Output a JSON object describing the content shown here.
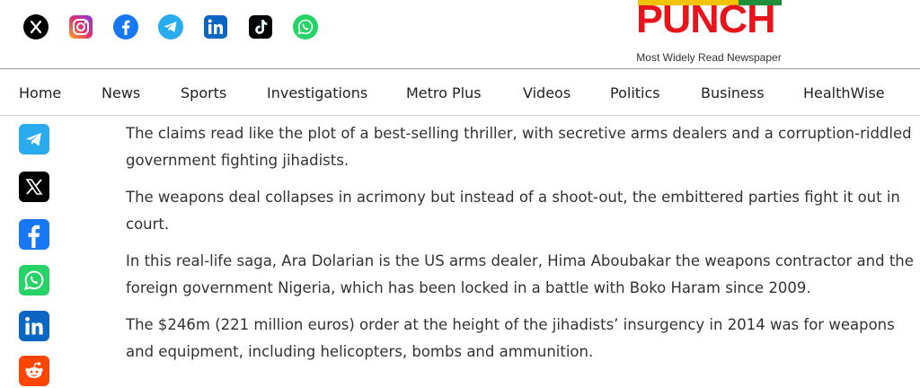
{
  "top_social": [
    {
      "name": "x-icon",
      "color": "#000000"
    },
    {
      "name": "instagram-icon",
      "color": "#e1306c"
    },
    {
      "name": "facebook-icon",
      "color": "#1877f2"
    },
    {
      "name": "telegram-icon",
      "color": "#2aabee"
    },
    {
      "name": "linkedin-icon",
      "color": "#0a66c2"
    },
    {
      "name": "tiktok-icon",
      "color": "#000000"
    },
    {
      "name": "whatsapp-icon",
      "color": "#25d366"
    }
  ],
  "logo": {
    "word": "PUNCH",
    "tagline": "Most Widely Read Newspaper",
    "colors": {
      "word": "#e8141b",
      "bar_yellow": "#f2c300",
      "bar_green": "#1f8f3a"
    }
  },
  "nav": {
    "items": [
      "Home",
      "News",
      "Sports",
      "Investigations",
      "Metro Plus",
      "Videos",
      "Politics",
      "Business",
      "HealthWise"
    ]
  },
  "share_bar": [
    {
      "name": "telegram-share-icon",
      "color": "#2aabee"
    },
    {
      "name": "x-share-icon",
      "color": "#000000"
    },
    {
      "name": "facebook-share-icon",
      "color": "#1877f2"
    },
    {
      "name": "whatsapp-share-icon",
      "color": "#25d366"
    },
    {
      "name": "linkedin-share-icon",
      "color": "#0a66c2"
    },
    {
      "name": "reddit-share-icon",
      "color": "#ff4500"
    }
  ],
  "article": {
    "paragraphs": [
      "The claims read like the plot of a best-selling thriller, with secretive arms dealers and a corruption-riddled government fighting jihadists.",
      "The weapons deal collapses in acrimony but instead of a shoot-out, the embittered parties fight it out in court.",
      "In this real-life saga, Ara Dolarian is the US arms dealer, Hima Aboubakar the weapons contractor and the foreign government Nigeria, which has been locked in a battle with Boko Haram since 2009.",
      "The $246m (221 million euros) order at the height of the jihadists’ insurgency in 2014 was for weapons and equipment, including helicopters, bombs and ammunition."
    ]
  }
}
